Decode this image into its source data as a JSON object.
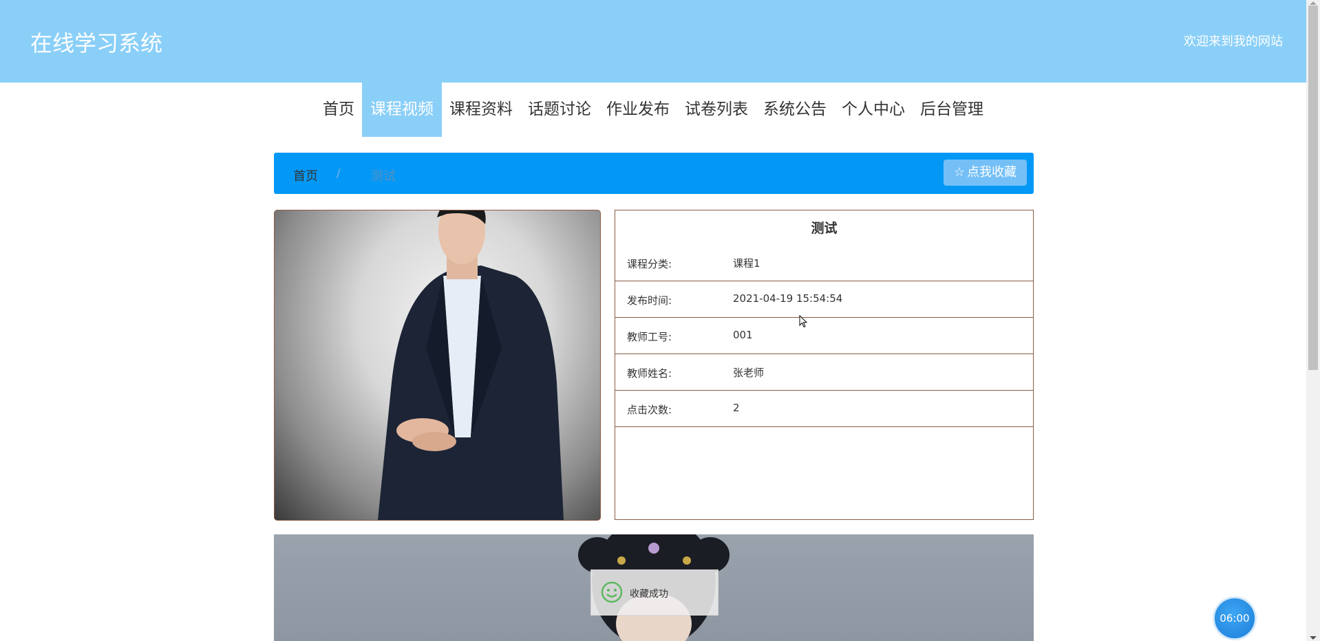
{
  "header": {
    "site_title": "在线学习系统",
    "welcome_text": "欢迎来到我的网站",
    "background_color": "#8acff8"
  },
  "nav": {
    "items": [
      {
        "label": "首页",
        "active": false
      },
      {
        "label": "课程视频",
        "active": true
      },
      {
        "label": "课程资料",
        "active": false
      },
      {
        "label": "话题讨论",
        "active": false
      },
      {
        "label": "作业发布",
        "active": false
      },
      {
        "label": "试卷列表",
        "active": false
      },
      {
        "label": "系统公告",
        "active": false
      },
      {
        "label": "个人中心",
        "active": false
      },
      {
        "label": "后台管理",
        "active": false
      }
    ]
  },
  "breadcrumb": {
    "home": "首页",
    "separator": "/",
    "current": "测试",
    "favorite_button": "点我收藏",
    "favorite_icon": "star-icon",
    "bar_color": "#0498f6"
  },
  "course": {
    "title": "测试",
    "fields": [
      {
        "label": "课程分类:",
        "value": "课程1"
      },
      {
        "label": "发布时间:",
        "value": "2021-04-19 15:54:54"
      },
      {
        "label": "教师工号:",
        "value": "001"
      },
      {
        "label": "教师姓名:",
        "value": "张老师"
      },
      {
        "label": "点击次数:",
        "value": "2"
      }
    ]
  },
  "toast": {
    "message": "收藏成功",
    "icon": "smile-icon"
  },
  "timer": {
    "text": "06:00"
  }
}
